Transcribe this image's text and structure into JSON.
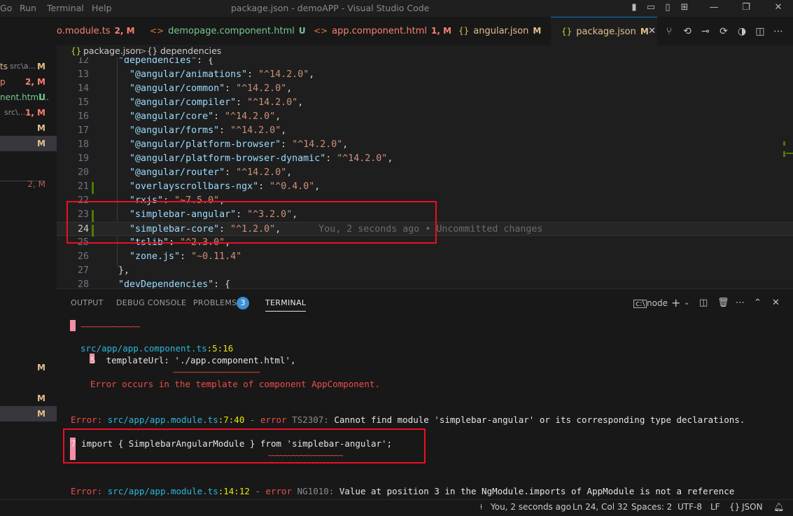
{
  "titlebar": {
    "menu": [
      "Go",
      "Run",
      "Terminal",
      "Help"
    ],
    "title": "package.json - demoAPP - Visual Studio Code"
  },
  "sidebar": {
    "items": [
      {
        "name": "ts",
        "sub": "src\\a...",
        "badge": "M",
        "color": "#e2c08d"
      },
      {
        "name": "p",
        "sub": "",
        "badge": "2, M",
        "color": "#f88070"
      },
      {
        "name": "nent.html...",
        "sub": "",
        "badge": "U",
        "color": "#73c991"
      },
      {
        "name": "",
        "sub": "src\\...",
        "badge": "1, M",
        "color": "#f88070"
      },
      {
        "name": "",
        "sub": "",
        "badge": "M",
        "color": "#e2c08d"
      },
      {
        "name": "",
        "sub": "",
        "badge": "M",
        "color": "#e2c08d"
      },
      {
        "name": "",
        "sub": "",
        "badge": "2, M",
        "color": "#b25a5a"
      },
      {
        "name": "",
        "sub": "",
        "badge": "M",
        "color": "#e2c08d"
      },
      {
        "name": "",
        "sub": "",
        "badge": "M",
        "color": "#e2c08d"
      },
      {
        "name": "",
        "sub": "",
        "badge": "M",
        "color": "#e2c08d"
      }
    ]
  },
  "tabs": [
    {
      "icon": "",
      "label": "o.module.ts",
      "badge": "2, M",
      "color": "#f88070",
      "icon_color": "#f88070"
    },
    {
      "icon": "<>",
      "label": "demopage.component.html",
      "badge": "U",
      "color": "#73c991",
      "icon_color": "#e37933"
    },
    {
      "icon": "<>",
      "label": "app.component.html",
      "badge": "1, M",
      "color": "#f88070",
      "icon_color": "#e37933"
    },
    {
      "icon": "{}",
      "label": "angular.json",
      "badge": "M",
      "color": "#e2c08d",
      "icon_color": "#cbcb41"
    },
    {
      "icon": "{}",
      "label": "package.json",
      "badge": "M",
      "color": "#e2c08d",
      "icon_color": "#cbcb41",
      "active": true
    }
  ],
  "breadcrumb": {
    "file": "package.json",
    "sep": ">",
    "symbol": "dependencies",
    "icon": "{}"
  },
  "editor": {
    "lines": [
      {
        "n": "12",
        "key": "dependencies",
        "val": "",
        "suffix": ": {",
        "indent": 1,
        "gutter": ""
      },
      {
        "n": "13",
        "key": "@angular/animations",
        "val": "^14.2.0",
        "indent": 2,
        "gutter": ""
      },
      {
        "n": "14",
        "key": "@angular/common",
        "val": "^14.2.0",
        "indent": 2,
        "gutter": ""
      },
      {
        "n": "15",
        "key": "@angular/compiler",
        "val": "^14.2.0",
        "indent": 2,
        "gutter": ""
      },
      {
        "n": "16",
        "key": "@angular/core",
        "val": "^14.2.0",
        "indent": 2,
        "gutter": ""
      },
      {
        "n": "17",
        "key": "@angular/forms",
        "val": "^14.2.0",
        "indent": 2,
        "gutter": ""
      },
      {
        "n": "18",
        "key": "@angular/platform-browser",
        "val": "^14.2.0",
        "indent": 2,
        "gutter": ""
      },
      {
        "n": "19",
        "key": "@angular/platform-browser-dynamic",
        "val": "^14.2.0",
        "indent": 2,
        "gutter": ""
      },
      {
        "n": "20",
        "key": "@angular/router",
        "val": "^14.2.0",
        "indent": 2,
        "gutter": ""
      },
      {
        "n": "21",
        "key": "overlayscrollbars-ngx",
        "val": "^0.4.0",
        "indent": 2,
        "gutter": "#487e02"
      },
      {
        "n": "22",
        "key": "rxjs",
        "val": "~7.5.0",
        "indent": 2,
        "gutter": ""
      },
      {
        "n": "23",
        "key": "simplebar-angular",
        "val": "^3.2.0",
        "indent": 2,
        "gutter": "#487e02"
      },
      {
        "n": "24",
        "key": "simplebar-core",
        "val": "^1.2.0",
        "indent": 2,
        "gutter": "#487e02",
        "current": true,
        "blame": "You, 2 seconds ago • Uncommitted changes"
      },
      {
        "n": "25",
        "key": "tslib",
        "val": "^2.3.0",
        "indent": 2,
        "gutter": ""
      },
      {
        "n": "26",
        "key": "zone.js",
        "val": "~0.11.4",
        "indent": 2,
        "gutter": "",
        "last": true
      },
      {
        "n": "27",
        "key": "",
        "val": "",
        "suffix": "},",
        "indent": 1,
        "gutter": ""
      },
      {
        "n": "28",
        "key": "devDependencies",
        "val": "",
        "suffix": ": {",
        "indent": 1,
        "gutter": ""
      }
    ]
  },
  "panel": {
    "tabs": [
      "OUTPUT",
      "DEBUG CONSOLE",
      "PROBLEMS",
      "TERMINAL"
    ],
    "problems_count": "3",
    "terminal_shell": "node",
    "terminal": {
      "squiggle1": "~~~~~~~~~~~~~~~",
      "loc1": "src/app/app.component.ts",
      "loc1_pos": ":5:16",
      "line5_no": "5",
      "line5_code": "  templateUrl: './app.component.html',",
      "squiggle2": "~~~~~~~~~~~~~~~~~~~~~~",
      "err_template": "Error occurs in the template of component AppComponent.",
      "err1_prefix": "Error: ",
      "err1_file": "src/app/app.module.ts",
      "err1_pos": ":7:40",
      "err1_sep": " - ",
      "err1_word": "error",
      "err1_code": " TS2307:",
      "err1_msg": " Cannot find module 'simplebar-angular' or its corresponding type declarations.",
      "line7_no": "7",
      "line7_code": " import { SimplebarAngularModule } from 'simplebar-angular';",
      "squiggle3": "~~~~~~~~~~~~~~~~~~~",
      "err2_prefix": "Error: ",
      "err2_file": "src/app/app.module.ts",
      "err2_pos": ":14:12",
      "err2_sep": " - ",
      "err2_word": "error",
      "err2_code": " NG1010:",
      "err2_msg": " Value at position 3 in the NgModule.imports of AppModule is not a reference"
    }
  },
  "statusbar": {
    "blame": "You, 2 seconds ago",
    "position": "Ln 24, Col 32",
    "spaces": "Spaces: 2",
    "encoding": "UTF-8",
    "eol": "LF",
    "language": "JSON",
    "lang_icon": "{}"
  }
}
